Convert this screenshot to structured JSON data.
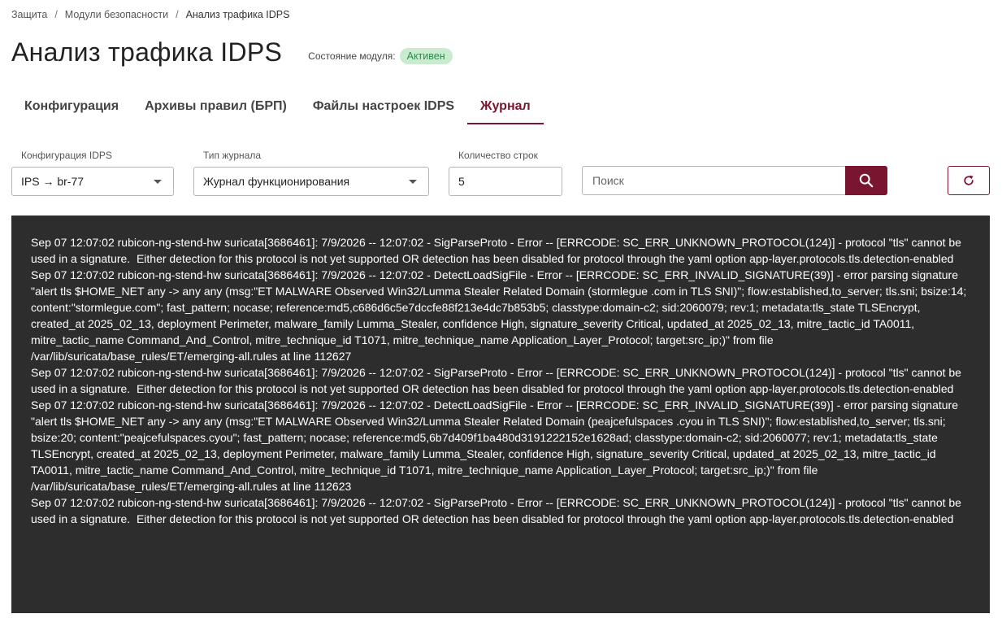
{
  "breadcrumb": {
    "items": [
      "Защита",
      "Модули безопасности"
    ],
    "current": "Анализ трафика IDPS",
    "separator": "/"
  },
  "header": {
    "title": "Анализ трафика IDPS",
    "module_state_label": "Состояние модуля:",
    "module_state_value": "Активен"
  },
  "tabs": [
    {
      "label": "Конфигурация",
      "active": false
    },
    {
      "label": "Архивы правил (БРП)",
      "active": false
    },
    {
      "label": "Файлы настроек IDPS",
      "active": false
    },
    {
      "label": "Журнал",
      "active": true
    }
  ],
  "filters": {
    "config": {
      "label": "Конфигурация IDPS",
      "value": "IPS → br-77"
    },
    "log_type": {
      "label": "Тип журнала",
      "value": "Журнал функционирования"
    },
    "rows": {
      "label": "Количество строк",
      "value": "5"
    },
    "search": {
      "placeholder": "Поиск",
      "value": ""
    }
  },
  "icons": {
    "search": "search-icon",
    "refresh": "refresh-icon",
    "dropdown": "chevron-down-icon"
  },
  "colors": {
    "accent": "#7a1530",
    "badge_bg": "#c9ecd1",
    "badge_text": "#2e8a46",
    "log_bg": "#2d2d2d"
  },
  "log": [
    "Sep 07 12:07:02 rubicon-ng-stend-hw suricata[3686461]: 7/9/2026 -- 12:07:02 - SigParseProto - Error -- [ERRCODE: SC_ERR_UNKNOWN_PROTOCOL(124)] - protocol \"tls\" cannot be used in a signature.  Either detection for this protocol is not yet supported OR detection has been disabled for protocol through the yaml option app-layer.protocols.tls.detection-enabled",
    "Sep 07 12:07:02 rubicon-ng-stend-hw suricata[3686461]: 7/9/2026 -- 12:07:02 - DetectLoadSigFile - Error -- [ERRCODE: SC_ERR_INVALID_SIGNATURE(39)] - error parsing signature \"alert tls $HOME_NET any -> any any (msg:\"ET MALWARE Observed Win32/Lumma Stealer Related Domain (stormlegue .com in TLS SNI)\"; flow:established,to_server; tls.sni; bsize:14; content:\"stormlegue.com\"; fast_pattern; nocase; reference:md5,c686d6c5e7dccfe88f213e4dc7b853b5; classtype:domain-c2; sid:2060079; rev:1; metadata:tls_state TLSEncrypt, created_at 2025_02_13, deployment Perimeter, malware_family Lumma_Stealer, confidence High, signature_severity Critical, updated_at 2025_02_13, mitre_tactic_id TA0011, mitre_tactic_name Command_And_Control, mitre_technique_id T1071, mitre_technique_name Application_Layer_Protocol; target:src_ip;)\" from file /var/lib/suricata/base_rules/ET/emerging-all.rules at line 112627",
    "Sep 07 12:07:02 rubicon-ng-stend-hw suricata[3686461]: 7/9/2026 -- 12:07:02 - SigParseProto - Error -- [ERRCODE: SC_ERR_UNKNOWN_PROTOCOL(124)] - protocol \"tls\" cannot be used in a signature.  Either detection for this protocol is not yet supported OR detection has been disabled for protocol through the yaml option app-layer.protocols.tls.detection-enabled",
    "Sep 07 12:07:02 rubicon-ng-stend-hw suricata[3686461]: 7/9/2026 -- 12:07:02 - DetectLoadSigFile - Error -- [ERRCODE: SC_ERR_INVALID_SIGNATURE(39)] - error parsing signature \"alert tls $HOME_NET any -> any any (msg:\"ET MALWARE Observed Win32/Lumma Stealer Related Domain (peajcefulspaces .cyou in TLS SNI)\"; flow:established,to_server; tls.sni; bsize:20; content:\"peajcefulspaces.cyou\"; fast_pattern; nocase; reference:md5,6b7d409f1ba480d3191222152e1628ad; classtype:domain-c2; sid:2060077; rev:1; metadata:tls_state TLSEncrypt, created_at 2025_02_13, deployment Perimeter, malware_family Lumma_Stealer, confidence High, signature_severity Critical, updated_at 2025_02_13, mitre_tactic_id TA0011, mitre_tactic_name Command_And_Control, mitre_technique_id T1071, mitre_technique_name Application_Layer_Protocol; target:src_ip;)\" from file /var/lib/suricata/base_rules/ET/emerging-all.rules at line 112623",
    "Sep 07 12:07:02 rubicon-ng-stend-hw suricata[3686461]: 7/9/2026 -- 12:07:02 - SigParseProto - Error -- [ERRCODE: SC_ERR_UNKNOWN_PROTOCOL(124)] - protocol \"tls\" cannot be used in a signature.  Either detection for this protocol is not yet supported OR detection has been disabled for protocol through the yaml option app-layer.protocols.tls.detection-enabled"
  ]
}
